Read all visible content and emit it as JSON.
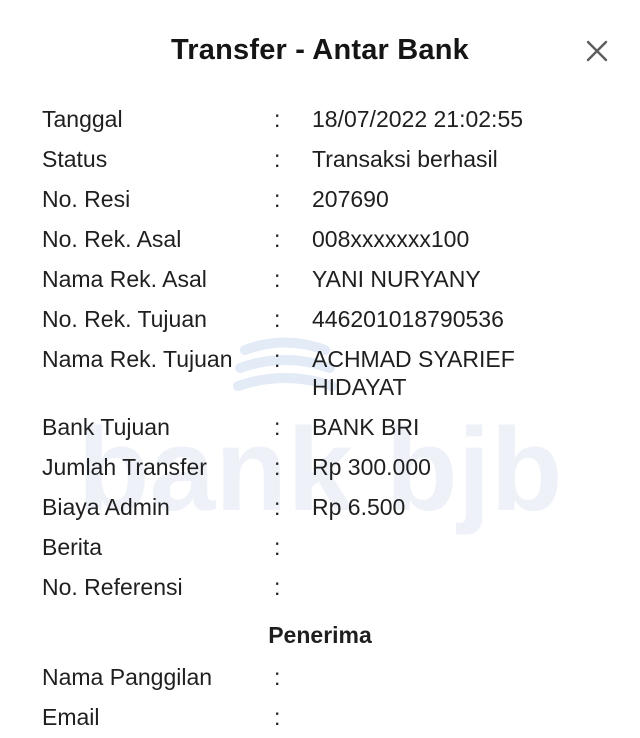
{
  "header": {
    "title": "Transfer - Antar Bank"
  },
  "watermark": {
    "brand": "bank bjb"
  },
  "details": [
    {
      "label": "Tanggal",
      "colon": ":",
      "value": "18/07/2022 21:02:55"
    },
    {
      "label": "Status",
      "colon": ":",
      "value": "Transaksi berhasil"
    },
    {
      "label": "No. Resi",
      "colon": ":",
      "value": "207690"
    },
    {
      "label": "No. Rek. Asal",
      "colon": ":",
      "value": "008xxxxxxx100"
    },
    {
      "label": "Nama Rek. Asal",
      "colon": ":",
      "value": "YANI NURYANY"
    },
    {
      "label": "No. Rek. Tujuan",
      "colon": ":",
      "value": "446201018790536"
    },
    {
      "label": "Nama Rek. Tujuan",
      "colon": ":",
      "value": "ACHMAD SYARIEF",
      "value2": "HIDAYAT"
    },
    {
      "label": "Bank Tujuan",
      "colon": ":",
      "value": "BANK BRI"
    },
    {
      "label": "Jumlah Transfer",
      "colon": ":",
      "value": "Rp 300.000"
    },
    {
      "label": "Biaya Admin",
      "colon": ":",
      "value": "Rp 6.500"
    },
    {
      "label": "Berita",
      "colon": ":",
      "value": ""
    },
    {
      "label": "No. Referensi",
      "colon": ":",
      "value": ""
    }
  ],
  "penerima": {
    "title": "Penerima",
    "items": [
      {
        "label": "Nama Panggilan",
        "colon": ":",
        "value": ""
      },
      {
        "label": "Email",
        "colon": ":",
        "value": ""
      }
    ]
  }
}
